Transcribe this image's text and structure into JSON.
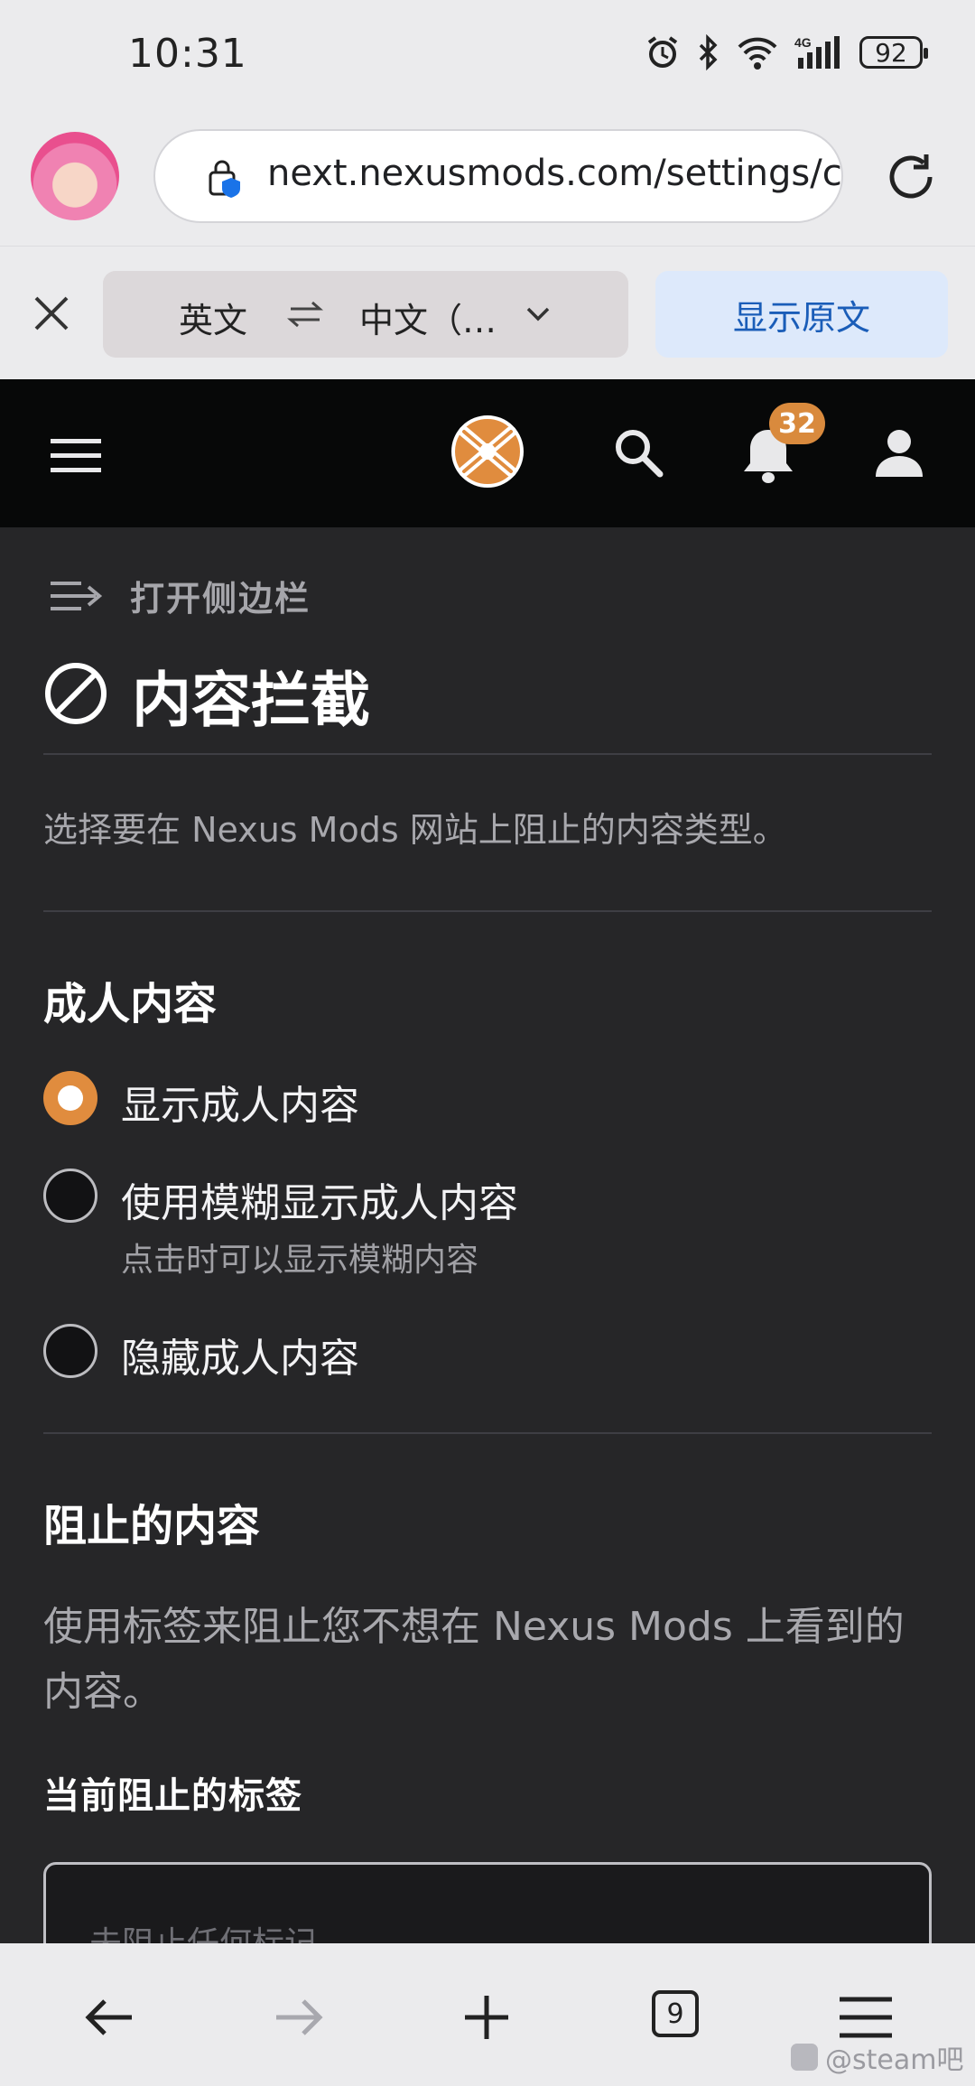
{
  "status_bar": {
    "time": "10:31",
    "battery": "92"
  },
  "browser": {
    "url": "next.nexusmods.com/settings/cc",
    "translate": {
      "source_lang": "英文",
      "target_lang": "中文（…",
      "show_original": "显示原文"
    }
  },
  "site_header": {
    "notification_count": "32"
  },
  "page": {
    "open_sidebar": "打开侧边栏",
    "title": "内容拦截",
    "intro": "选择要在 Nexus Mods 网站上阻止的内容类型。",
    "adult": {
      "heading": "成人内容",
      "options": [
        {
          "label": "显示成人内容",
          "sub": "",
          "selected": true
        },
        {
          "label": "使用模糊显示成人内容",
          "sub": "点击时可以显示模糊内容",
          "selected": false
        },
        {
          "label": "隐藏成人内容",
          "sub": "",
          "selected": false
        }
      ]
    },
    "blocked": {
      "heading": "阻止的内容",
      "description": "使用标签来阻止您不想在 Nexus Mods 上看到的内容。",
      "current_tags_heading": "当前阻止的标签",
      "empty_text": "未阻止任何标记"
    }
  },
  "bottom_nav": {
    "tab_count": "9"
  },
  "watermark": "@steam吧",
  "colors": {
    "accent": "#e08c3e",
    "header_bg": "#070808",
    "content_bg": "#262628",
    "translate_button": "#1a5db8"
  },
  "icons": [
    "alarm-icon",
    "bluetooth-icon",
    "wifi-icon",
    "signal-icon",
    "lock-shield-icon",
    "reload-icon",
    "close-icon",
    "swap-icon",
    "chevron-down-icon",
    "menu-icon",
    "nexus-logo",
    "search-icon",
    "bell-icon",
    "user-icon",
    "sidebar-open-icon",
    "block-icon",
    "back-icon",
    "forward-icon",
    "new-tab-icon",
    "tabs-icon",
    "browser-menu-icon"
  ]
}
